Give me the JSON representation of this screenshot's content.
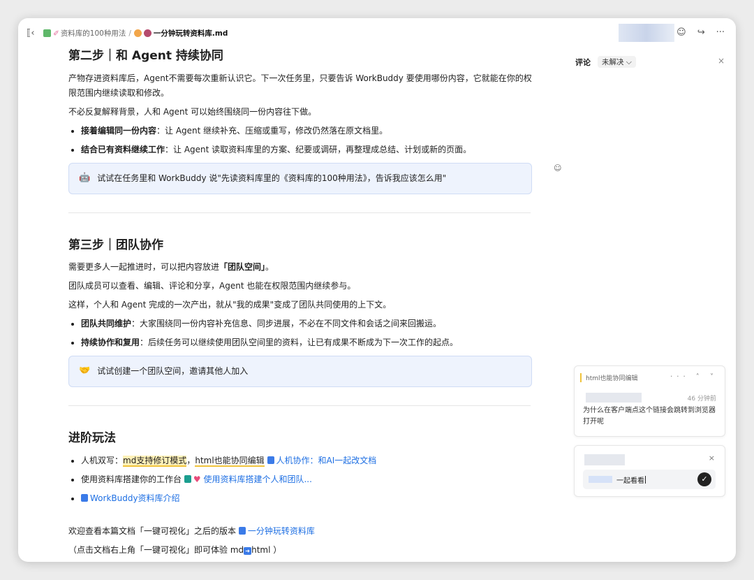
{
  "breadcrumb": {
    "parent": "资料库的100种用法",
    "sep": "/",
    "current": "一分钟玩转资料库.md"
  },
  "toolbar": {
    "comment_icon": "comment-icon",
    "share_icon": "share-icon",
    "more": "···"
  },
  "step2": {
    "title": "第二步｜和 Agent 持续协同",
    "p1": "产物存进资料库后，Agent不需要每次重新认识它。下一次任务里，只要告诉 WorkBuddy 要使用哪份内容，它就能在你的权限范围内继续读取和修改。",
    "p2": "不必反复解释背景，人和 Agent 可以始终围绕同一份内容往下做。",
    "bullets": [
      {
        "bold": "接着编辑同一份内容",
        "text": "：让 Agent 继续补充、压缩或重写，修改仍然落在原文档里。"
      },
      {
        "bold": "结合已有资料继续工作",
        "text": "：让 Agent 读取资料库里的方案、纪要或调研，再整理成总结、计划或新的页面。"
      }
    ],
    "callout": "试试在任务里和 WorkBuddy 说\"先读资料库里的《资料库的100种用法》，告诉我应该怎么用\""
  },
  "step3": {
    "title": "第三步｜团队协作",
    "p1_pre": "需要更多人一起推进时，可以把内容放进",
    "p1_bold": "「团队空间」",
    "p1_post": "。",
    "p2": "团队成员可以查看、编辑、评论和分享，Agent 也能在权限范围内继续参与。",
    "p3": "这样，个人和 Agent 完成的一次产出，就从\"我的成果\"变成了团队共同使用的上下文。",
    "bullets": [
      {
        "bold": "团队共同维护",
        "text": "：大家围绕同一份内容补充信息、同步进展，不必在不同文件和会话之间来回搬运。"
      },
      {
        "bold": "持续协作和复用",
        "text": "：后续任务可以继续使用团队空间里的资料，让已有成果不断成为下一次工作的起点。"
      }
    ],
    "callout": "试试创建一个团队空间，邀请其他人加入"
  },
  "advanced": {
    "title": "进阶玩法",
    "item1_pre": "人机双写：",
    "item1_hl": "md支持修订模式",
    "item1_mid": "，",
    "item1_ul": "html也能协同编辑",
    "item1_link": "人机协作：和AI一起改文档",
    "item2_pre": "使用资料库搭建你的工作台",
    "item2_link": "使用资料库搭建个人和团队...",
    "item3_link": "WorkBuddy资料库介绍"
  },
  "footer": {
    "line1_pre": "欢迎查看本篇文档「一键可视化」之后的版本",
    "line1_link": "一分钟玩转资料库",
    "line2_pre": "（点击文档右上角「一键可视化」即可体验 md",
    "line2_post": "html ）"
  },
  "comments": {
    "title": "评论",
    "filter": "未解决 ⌵",
    "close": "×",
    "thread": {
      "quote": "html也能协同编辑",
      "actions": "··· ˄ ˅",
      "time": "46 分钟前",
      "body": "为什么在客户端点这个链接会跳转到浏览器打开呢"
    },
    "reply": {
      "close": "×",
      "input_text": "一起看看",
      "send": "✓"
    }
  }
}
